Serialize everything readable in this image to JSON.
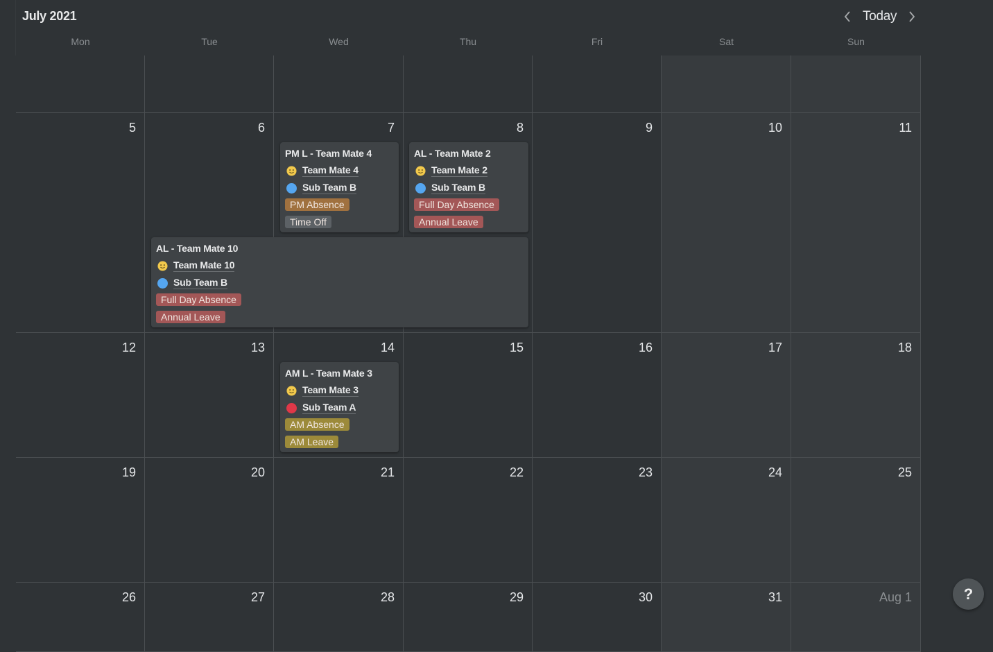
{
  "header": {
    "title": "July 2021",
    "today_label": "Today",
    "prev_icon": "chevron-left-icon",
    "next_icon": "chevron-right-icon"
  },
  "weekdays": [
    "Mon",
    "Tue",
    "Wed",
    "Thu",
    "Fri",
    "Sat",
    "Sun"
  ],
  "weeks": [
    [
      "",
      "",
      "",
      "",
      "",
      "",
      ""
    ],
    [
      "5",
      "6",
      "7",
      "8",
      "9",
      "10",
      "11"
    ],
    [
      "12",
      "13",
      "14",
      "15",
      "16",
      "17",
      "18"
    ],
    [
      "19",
      "20",
      "21",
      "22",
      "23",
      "24",
      "25"
    ],
    [
      "26",
      "27",
      "28",
      "29",
      "30",
      "31",
      "Aug 1"
    ]
  ],
  "colors": {
    "pm_absence": "#a0713f",
    "time_off": "#5c6165",
    "full_day_absence": "#a35757",
    "annual_leave": "#a35757",
    "am_absence": "#9c8a3a",
    "am_leave": "#9c8a3a",
    "sub_team_a": "#e03848",
    "sub_team_b": "#55a6f0",
    "smiley": "#f2c94c"
  },
  "events": [
    {
      "title": "PM L - Team Mate 4",
      "person": "Team Mate 4",
      "team": "Sub Team B",
      "tags": [
        "PM Absence",
        "Time Off"
      ]
    },
    {
      "title": "AL - Team Mate 2",
      "person": "Team Mate 2",
      "team": "Sub Team B",
      "tags": [
        "Full Day Absence",
        "Annual Leave"
      ]
    },
    {
      "title": "AL - Team Mate 10",
      "person": "Team Mate 10",
      "team": "Sub Team B",
      "tags": [
        "Full Day Absence",
        "Annual Leave"
      ]
    },
    {
      "title": "AM L - Team Mate 3",
      "person": "Team Mate 3",
      "team": "Sub Team A",
      "tags": [
        "AM Absence",
        "AM Leave"
      ]
    }
  ],
  "help_button": {
    "label": "?"
  }
}
